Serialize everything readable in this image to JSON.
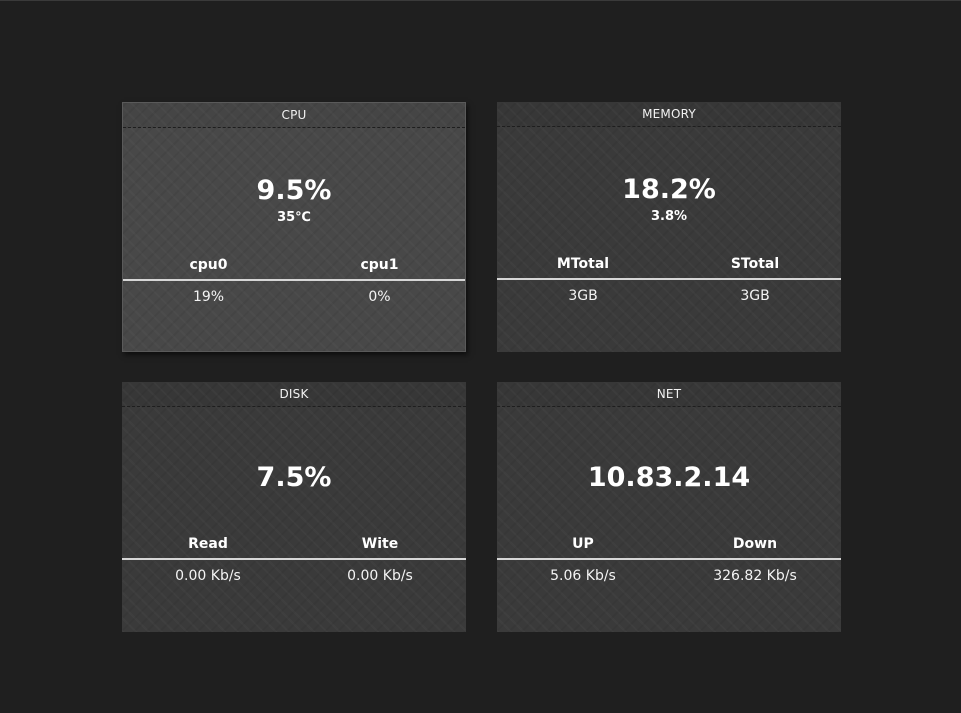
{
  "cards": {
    "cpu": {
      "title": "CPU",
      "main": "9.5%",
      "sub": "35℃",
      "columns": [
        "cpu0",
        "cpu1"
      ],
      "values": [
        "19%",
        "0%"
      ]
    },
    "memory": {
      "title": "MEMORY",
      "main": "18.2%",
      "sub": "3.8%",
      "columns": [
        "MTotal",
        "STotal"
      ],
      "values": [
        "3GB",
        "3GB"
      ]
    },
    "disk": {
      "title": "DISK",
      "main": "7.5%",
      "columns": [
        "Read",
        "Wite"
      ],
      "values": [
        "0.00 Kb/s",
        "0.00 Kb/s"
      ]
    },
    "net": {
      "title": "NET",
      "main": "10.83.2.14",
      "columns": [
        "UP",
        "Down"
      ],
      "values": [
        "5.06 Kb/s",
        "326.82 Kb/s"
      ]
    }
  },
  "colors": {
    "background": "#1f1f1f",
    "card": "#3a3a3a",
    "card_active": "#484848",
    "text": "#ffffff"
  }
}
